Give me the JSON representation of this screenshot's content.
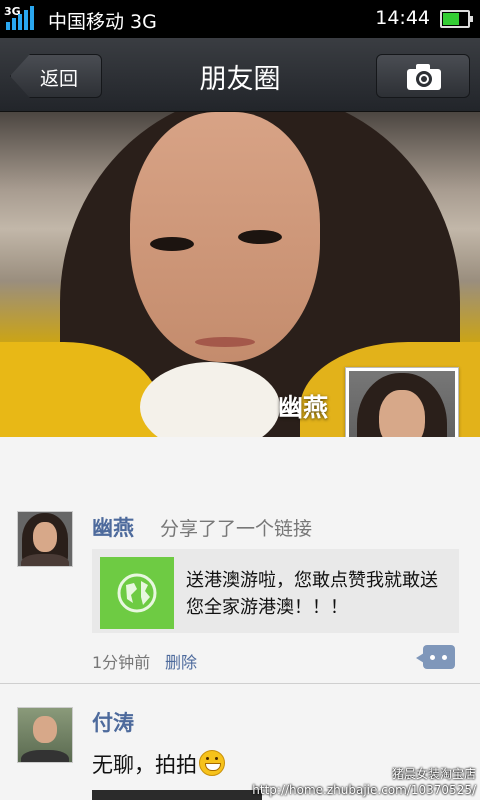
{
  "status_bar": {
    "network_badge": "3G",
    "carrier": "中国移动 3G",
    "time": "14:44",
    "battery_level": 0.65,
    "signal_color": "#2aa7f0",
    "battery_color": "#33cc33"
  },
  "header": {
    "back_label": "返回",
    "title": "朋友圈",
    "camera_icon": "camera-icon"
  },
  "cover": {
    "user_name": "幽燕"
  },
  "feed": {
    "posts": [
      {
        "author": "幽燕",
        "action": "分享了了一个链接",
        "link_text": "送港澳游啦，您敢点赞我就敢送您全家游港澳！！！",
        "link_icon": "globe-icon",
        "time": "1分钟前",
        "delete_label": "删除",
        "comment_icon": "comment-icon"
      },
      {
        "author": "付涛",
        "text": "无聊，拍拍",
        "emoji": "grin-emoji"
      }
    ]
  },
  "watermark": {
    "line1": "猪晨女装淘宝店",
    "line2": "http://home.zhubajie.com/10370525/"
  },
  "colors": {
    "author_link": "#4d6a9c",
    "title_bar": "#2d3035",
    "link_thumb": "#6ecb43"
  }
}
